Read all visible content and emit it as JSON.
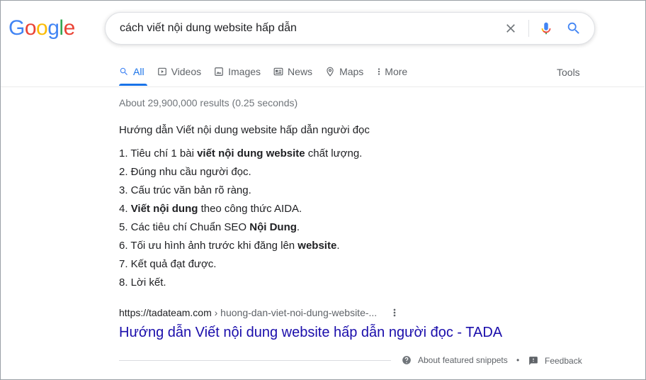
{
  "logo": {
    "letters": [
      "G",
      "o",
      "o",
      "g",
      "l",
      "e"
    ],
    "colors": [
      "#4285F4",
      "#EA4335",
      "#FBBC05",
      "#4285F4",
      "#34A853",
      "#EA4335"
    ]
  },
  "search": {
    "query": "cách viết nội dung website hấp dẫn"
  },
  "tabs": [
    {
      "label": "All",
      "icon": "search-icon",
      "active": true
    },
    {
      "label": "Videos",
      "icon": "video-icon"
    },
    {
      "label": "Images",
      "icon": "image-icon"
    },
    {
      "label": "News",
      "icon": "news-icon"
    },
    {
      "label": "Maps",
      "icon": "map-pin-icon"
    },
    {
      "label": "More",
      "icon": "more-vert-icon"
    }
  ],
  "tools_label": "Tools",
  "result_stats": "About 29,900,000 results (0.25 seconds)",
  "snippet": {
    "heading": "Hướng dẫn Viết nội dung website hấp dẫn người đọc",
    "items": [
      {
        "prefix": "1. Tiêu chí 1 bài ",
        "bold": "viết nội dung website",
        "suffix": " chất lượng."
      },
      {
        "prefix": "2. Đúng nhu cầu người đọc.",
        "bold": "",
        "suffix": ""
      },
      {
        "prefix": "3. Cấu trúc văn bản rõ ràng.",
        "bold": "",
        "suffix": ""
      },
      {
        "prefix": "4. ",
        "bold": "Viết nội dung",
        "suffix": " theo công thức AIDA."
      },
      {
        "prefix": "5. Các tiêu chí Chuẩn SEO ",
        "bold": "Nội Dung",
        "suffix": "."
      },
      {
        "prefix": "6. Tối ưu hình ảnh trước khi đăng lên ",
        "bold": "website",
        "suffix": "."
      },
      {
        "prefix": "7. Kết quả đạt được.",
        "bold": "",
        "suffix": ""
      },
      {
        "prefix": "8. Lời kết.",
        "bold": "",
        "suffix": ""
      }
    ]
  },
  "result": {
    "domain": "https://tadateam.com",
    "path": " › huong-dan-viet-noi-dung-website-...",
    "title": "Hướng dẫn Viết nội dung website hấp dẫn người đọc - TADA"
  },
  "footer": {
    "about_label": "About featured snippets",
    "separator": "•",
    "feedback_label": "Feedback"
  },
  "colors": {
    "link": "#1a0dab",
    "accent": "#1a73e8",
    "muted": "#5f6368"
  }
}
